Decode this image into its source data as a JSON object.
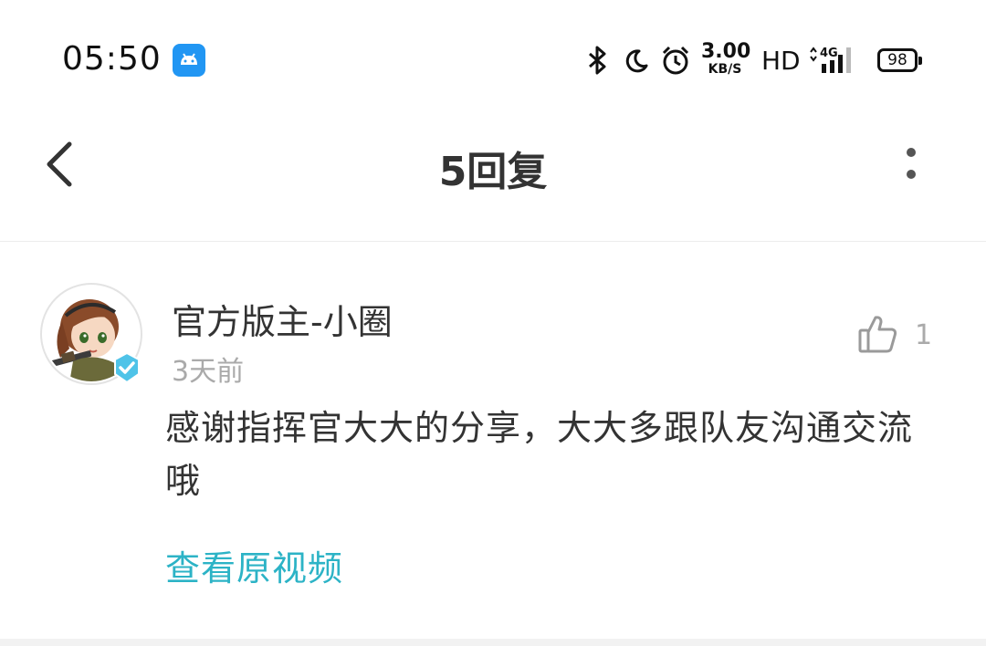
{
  "status_bar": {
    "time": "05:50",
    "net_speed_value": "3.00",
    "net_speed_unit": "KB/S",
    "hd_label": "HD",
    "network_label": "4G",
    "battery_level": "98",
    "icons": [
      "android-app-icon",
      "bluetooth-icon",
      "moon-icon",
      "alarm-icon",
      "signal-icon",
      "battery-icon"
    ]
  },
  "nav": {
    "title": "5回复",
    "back_icon": "chevron-left-icon",
    "more_icon": "more-vertical-icon"
  },
  "comment": {
    "username": "官方版主-小圈",
    "timestamp": "3天前",
    "like_count": "1",
    "text": "感谢指挥官大大的分享，大大多跟队友沟通交流哦",
    "view_video_label": "查看原视频"
  },
  "colors": {
    "accent": "#2cb3c6",
    "android_blue": "#2196f3",
    "verified_badge": "#4fc3e8",
    "muted_text": "#aaaaaa"
  }
}
